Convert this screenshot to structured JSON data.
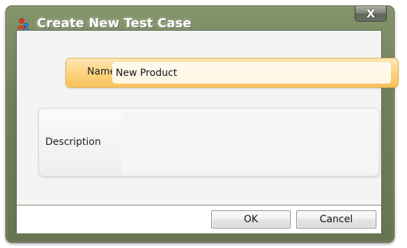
{
  "window": {
    "title": "Create New Test Case",
    "close_label": "X"
  },
  "form": {
    "name_label": "Name",
    "name_value": "New Product",
    "description_label": "Description",
    "description_value": ""
  },
  "buttons": {
    "ok_label": "OK",
    "cancel_label": "Cancel"
  },
  "colors": {
    "frame": "#6f7f5a",
    "name_group_accent": "#fbd27a",
    "client_background": "#f4f4f4"
  },
  "icons": {
    "app": "test-case-app-icon",
    "close": "close-icon"
  }
}
